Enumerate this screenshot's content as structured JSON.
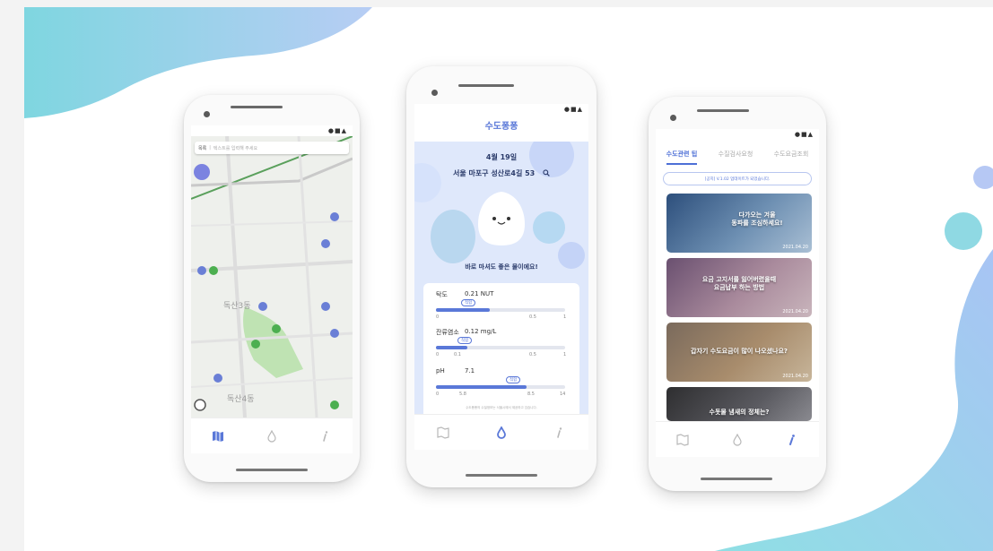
{
  "colors": {
    "accent": "#5a78d8",
    "blob_teal": "#8fd9e3",
    "blob_blue": "#a9c6f5",
    "map_green": "#8dcc7e",
    "map_road": "#5aa05c"
  },
  "status_icons": "●■▲",
  "nav_icons": [
    "map-icon",
    "water-drop-icon",
    "info-icon"
  ],
  "map_screen": {
    "search_prefix": "목록",
    "search_placeholder": "텍스트를 입력해 주세요",
    "district_labels": [
      "독산3동",
      "독산4동"
    ],
    "active_nav": "map"
  },
  "water_screen": {
    "title": "수도퐁퐁",
    "date": "4월 19일",
    "address": "서울 마포구 성산로4길 53",
    "message": "바로 마셔도 좋은 물이에요!",
    "metrics": [
      {
        "name": "탁도",
        "value": "0.21 NUT",
        "badge": "적합",
        "level": 0.42,
        "ticks": [
          "0",
          "0.5",
          "1"
        ]
      },
      {
        "name": "잔류염소",
        "value": "0.12 mg/L",
        "badge": "적합",
        "level": 0.24,
        "ticks": [
          "0",
          "0.1",
          "0.5",
          "1"
        ]
      },
      {
        "name": "pH",
        "value": "7.1",
        "badge": "적합",
        "level": 0.7,
        "ticks": [
          "0",
          "5.8",
          "8.5",
          "14"
        ]
      }
    ],
    "footnote": "수도퐁퐁의 수질정보는 서울시에서 제공하고 있습니다.",
    "active_nav": "water"
  },
  "info_screen": {
    "tabs": [
      "수도관련 팁",
      "수질검사요청",
      "수도요금조회"
    ],
    "notice": "[공지] V.1.02 업데이트가 되었습니다.",
    "posts": [
      {
        "title": "다가오는 겨울\n동파를 조심하세요!",
        "date": "2021.04.20"
      },
      {
        "title": "요금 고지서를 잃어버렸을때\n요금납부 하는 방법",
        "date": "2021.04.20"
      },
      {
        "title": "갑자기 수도요금이 많이 나오셨나요?",
        "date": "2021.04.20"
      },
      {
        "title": "수돗물 냄새의 정체는?",
        "date": ""
      }
    ],
    "active_nav": "info"
  }
}
